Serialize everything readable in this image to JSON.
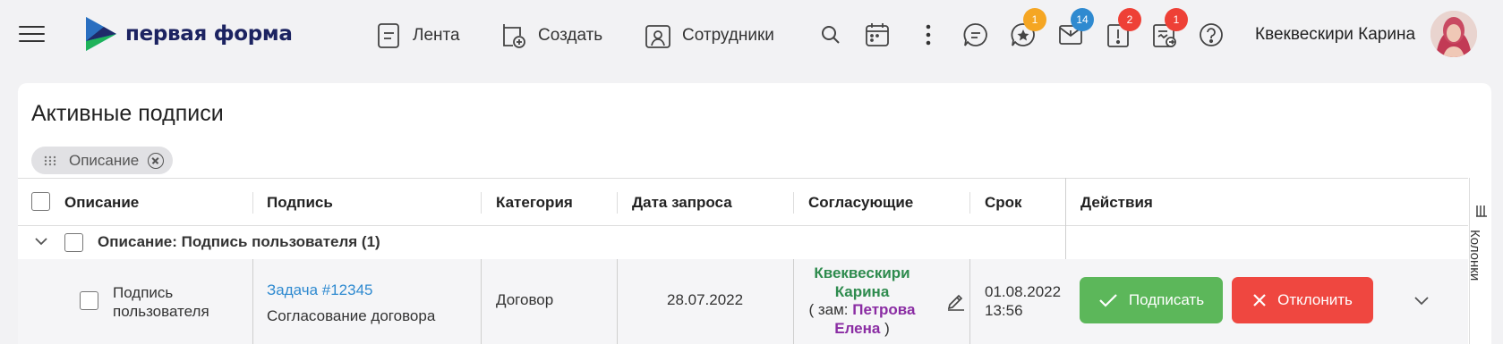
{
  "header": {
    "logo_text": "первая форма",
    "nav": {
      "feed": "Лента",
      "create": "Создать",
      "employees": "Сотрудники"
    },
    "badges": {
      "favorites": "1",
      "mail": "14",
      "alerts": "2",
      "approvals": "1"
    },
    "badge_colors": {
      "favorites": "#f5a623",
      "mail": "#2f8ad0",
      "alerts": "#ee4036",
      "approvals": "#ee4036"
    },
    "user_name": "Квеквескири Карина"
  },
  "page": {
    "title": "Активные подписи",
    "group_chip": "Описание"
  },
  "table": {
    "columns": {
      "description": "Описание",
      "signature": "Подпись",
      "category": "Категория",
      "request_date": "Дата запроса",
      "approvers": "Согласующие",
      "deadline": "Срок",
      "actions": "Действия"
    },
    "group_label": "Описание: Подпись пользователя (1)",
    "rows": [
      {
        "description_line1": "Подпись",
        "description_line2": "пользователя",
        "task_link": "Задача #12345",
        "task_subtitle": "Согласование договора",
        "category": "Договор",
        "request_date": "28.07.2022",
        "approver_line1": "Квеквескири",
        "approver_line2": "Карина",
        "deputy_prefix": "( зам: ",
        "deputy_line1": "Петрова",
        "deputy_line2": "Елена",
        "deputy_suffix": " )",
        "deadline_date": "01.08.2022",
        "deadline_time": "13:56",
        "sign_label": "Подписать",
        "reject_label": "Отклонить"
      }
    ],
    "columns_panel_label": "Колонки"
  },
  "colors": {
    "brand_navy": "#1c2361",
    "sign_green": "#5cb75a",
    "reject_red": "#ef4740",
    "link_blue": "#2f8ad0",
    "approver_green": "#2e8b4e",
    "deputy_purple": "#8a2ca3"
  }
}
